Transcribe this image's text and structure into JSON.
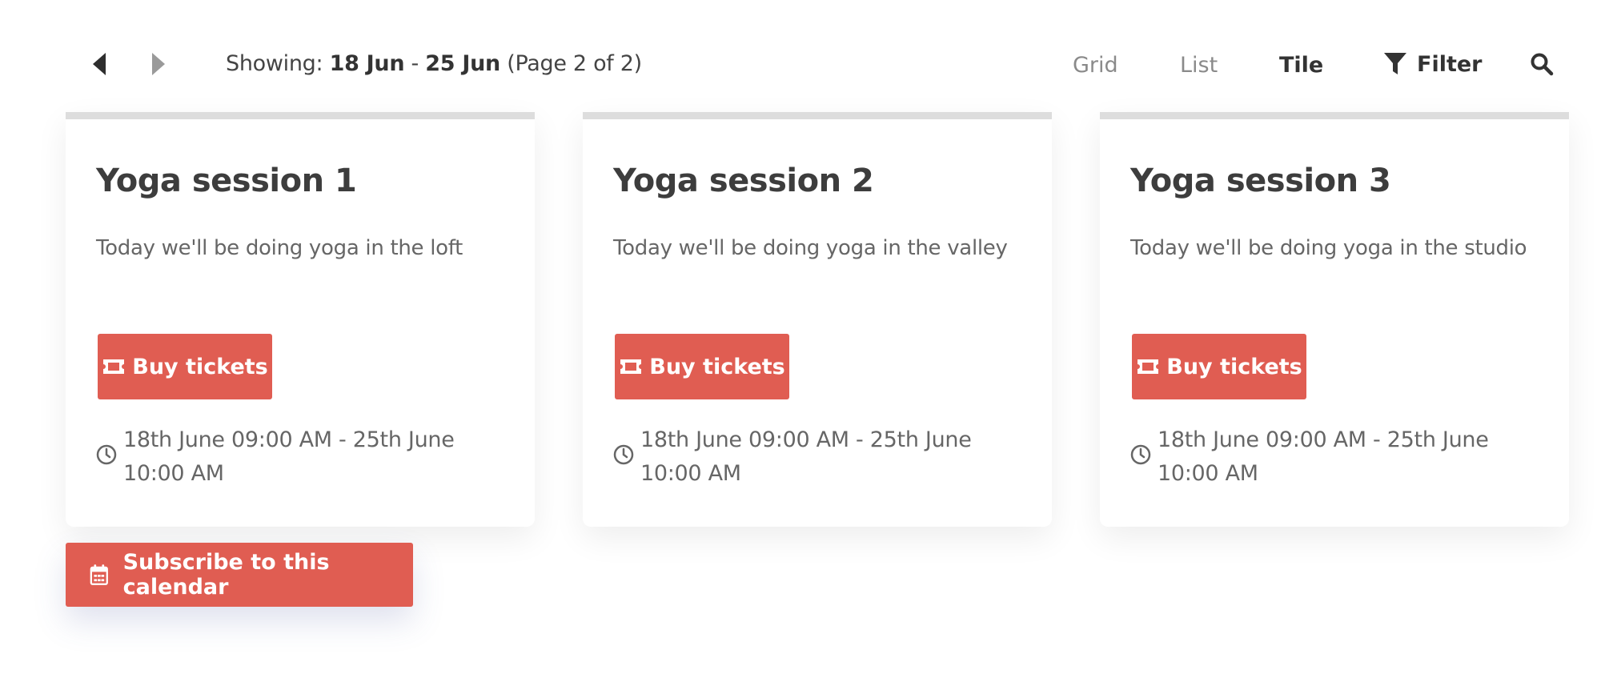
{
  "toolbar": {
    "prev_icon": "caret-left-icon",
    "next_icon": "caret-right-icon",
    "showing_prefix": "Showing: ",
    "range_start": "18 Jun",
    "range_separator": " - ",
    "range_end": "25 Jun",
    "page_info": " (Page 2 of 2)",
    "views": {
      "grid": "Grid",
      "list": "List",
      "tile": "Tile"
    },
    "active_view": "Tile",
    "filter_label": "Filter",
    "filter_icon": "filter-icon",
    "search_icon": "search-icon"
  },
  "events": [
    {
      "title": "Yoga session 1",
      "description": "Today we'll be doing yoga in the loft",
      "button_label": "Buy tickets",
      "button_icon": "ticket-icon",
      "time_line1": "18th June 09:00 AM - 25th June",
      "time_line2": "10:00 AM",
      "time_icon": "clock-icon"
    },
    {
      "title": "Yoga session 2",
      "description": "Today we'll be doing yoga in the valley",
      "button_label": "Buy tickets",
      "button_icon": "ticket-icon",
      "time_line1": "18th June 09:00 AM - 25th June",
      "time_line2": "10:00 AM",
      "time_icon": "clock-icon"
    },
    {
      "title": "Yoga session 3",
      "description": "Today we'll be doing yoga in the studio",
      "button_label": "Buy tickets",
      "button_icon": "ticket-icon",
      "time_line1": "18th June 09:00 AM - 25th June",
      "time_line2": "10:00 AM",
      "time_icon": "clock-icon"
    }
  ],
  "subscribe": {
    "label": "Subscribe to this calendar",
    "icon": "calendar-icon"
  },
  "colors": {
    "accent": "#e05d52",
    "card_top_border": "#dddddd",
    "text_dark": "#3d3d3d",
    "text_muted": "#666666",
    "inactive_view": "#8a8a8a"
  }
}
